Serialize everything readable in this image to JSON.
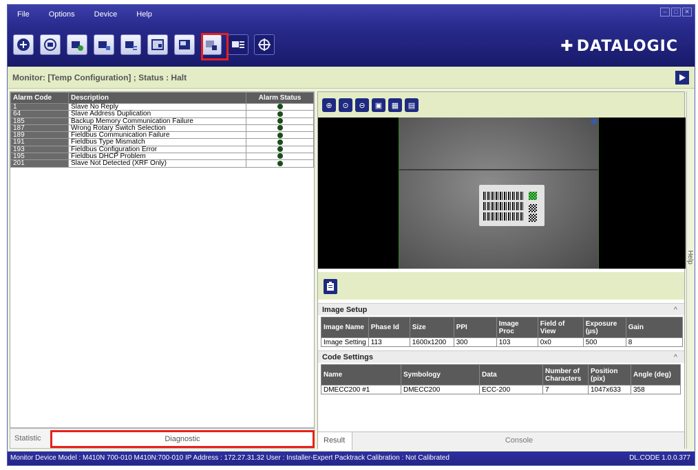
{
  "menu": [
    "File",
    "Options",
    "Device",
    "Help"
  ],
  "window_controls": [
    "–",
    "□",
    "✕"
  ],
  "toolbar": {
    "buttons": [
      "new-configuration",
      "device-discovery",
      "add-device",
      "connect-device",
      "disconnect-device",
      "monitor",
      "diagnostics",
      "image-capture",
      "settings",
      "target"
    ],
    "highlighted_index": 6
  },
  "brand": {
    "logo_text": "DATALOGIC"
  },
  "monitor": {
    "text": "Monitor:  [Temp Configuration] ;  Status :  Halt"
  },
  "alarm_table": {
    "headers": [
      "Alarm Code",
      "Description",
      "Alarm Status"
    ],
    "rows": [
      {
        "code": "1",
        "description": "Slave No Reply"
      },
      {
        "code": "64",
        "description": "Slave Address Duplication"
      },
      {
        "code": "185",
        "description": "Backup Memory Communication Failure"
      },
      {
        "code": "187",
        "description": "Wrong Rotary Switch Selection"
      },
      {
        "code": "189",
        "description": "Fieldbus Communication Failure"
      },
      {
        "code": "191",
        "description": "Fieldbus Type Mismatch"
      },
      {
        "code": "193",
        "description": "Fieldbus Configuration Error"
      },
      {
        "code": "195",
        "description": "Fieldbus DHCP Problem"
      },
      {
        "code": "201",
        "description": "Slave Not Detected (XRF Only)"
      }
    ]
  },
  "left_tabs": {
    "statistic": "Statistic",
    "diagnostic": "Diagnostic"
  },
  "image_setup": {
    "title": "Image Setup",
    "headers": [
      "Image Name",
      "Phase Id",
      "Size",
      "PPI",
      "Image Proc",
      "Field of View",
      "Exposure (µs)",
      "Gain"
    ],
    "row": [
      "Image Setting",
      "113",
      "1600x1200",
      "300",
      "103",
      "0x0",
      "500",
      "8"
    ]
  },
  "code_settings": {
    "title": "Code Settings",
    "headers": [
      "Name",
      "Symbology",
      "Data",
      "Number of Characters",
      "Position (pix)",
      "Angle (deg)"
    ],
    "row": [
      "DMECC200  #1",
      "DMECC200",
      "ECC-200",
      "7",
      "1047x633",
      "358"
    ]
  },
  "right_tabs": {
    "result": "Result",
    "console": "Console"
  },
  "help": "Help",
  "status_bar": {
    "text": "Monitor   Device Model : M410N   700-010   M410N:700-010   IP Address :  172.27.31.32   User : Installer-Expert   Packtrack Calibration : Not Calibrated",
    "version": "DL.CODE 1.0.0.377"
  },
  "colors": {
    "accent_red": "#e8201b",
    "navy": "#1e2a80",
    "panel_green": "#e4ecc6"
  }
}
